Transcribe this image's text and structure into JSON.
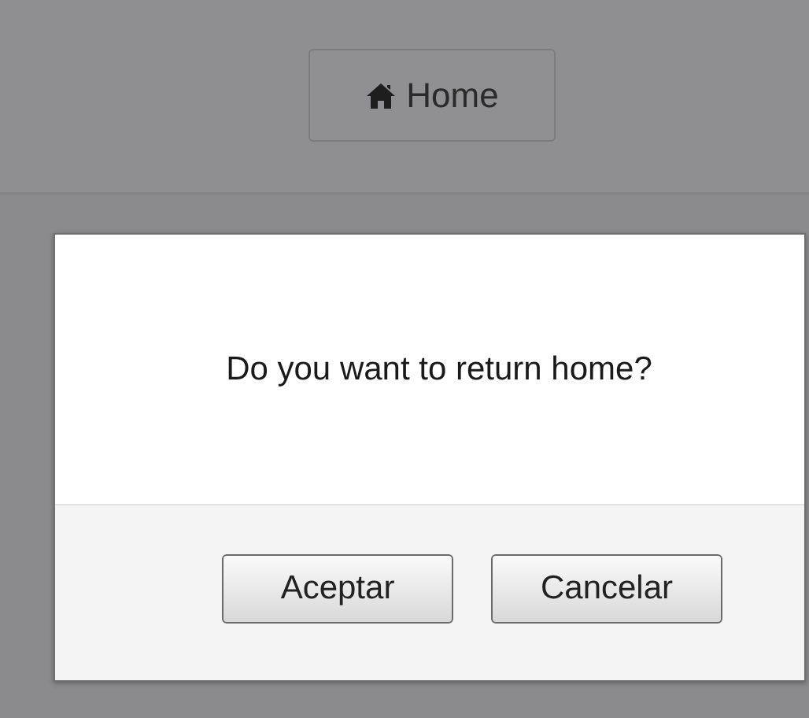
{
  "header": {
    "home_button": "Home"
  },
  "dialog": {
    "message": "Do you want to return home?",
    "buttons": [
      "Aceptar",
      "Cancelar"
    ]
  }
}
